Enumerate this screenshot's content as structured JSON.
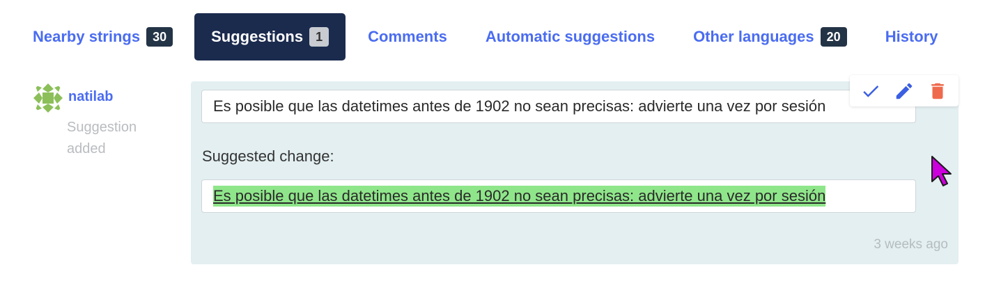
{
  "tabs": [
    {
      "label": "Nearby strings",
      "count": "30"
    },
    {
      "label": "Suggestions",
      "count": "1"
    },
    {
      "label": "Comments"
    },
    {
      "label": "Automatic suggestions"
    },
    {
      "label": "Other languages",
      "count": "20"
    },
    {
      "label": "History"
    }
  ],
  "active_tab": "Suggestions",
  "suggestion": {
    "user": "natilab",
    "action": "Suggestion added",
    "original_text": "Es posible que las datetimes antes de 1902 no sean precisas: advierte una vez por sesión",
    "change_label": "Suggested change:",
    "suggested_text": "Es posible que las datetimes antes de 1902 no sean precisas: advierte una vez por sesión",
    "timestamp": "3 weeks ago"
  },
  "actions": [
    {
      "name": "accept",
      "icon": "check-icon",
      "color": "#3b5fe2"
    },
    {
      "name": "edit",
      "icon": "pencil-icon",
      "color": "#3b5fe2"
    },
    {
      "name": "delete",
      "icon": "trash-icon",
      "color": "#ef6a4c"
    }
  ],
  "colors": {
    "accent": "#4a6cf0",
    "active_tab_bg": "#1b2b4e",
    "panel_bg": "#e3eff1",
    "diff_insert": "#8fe68a",
    "cursor": "#cc00dd"
  }
}
